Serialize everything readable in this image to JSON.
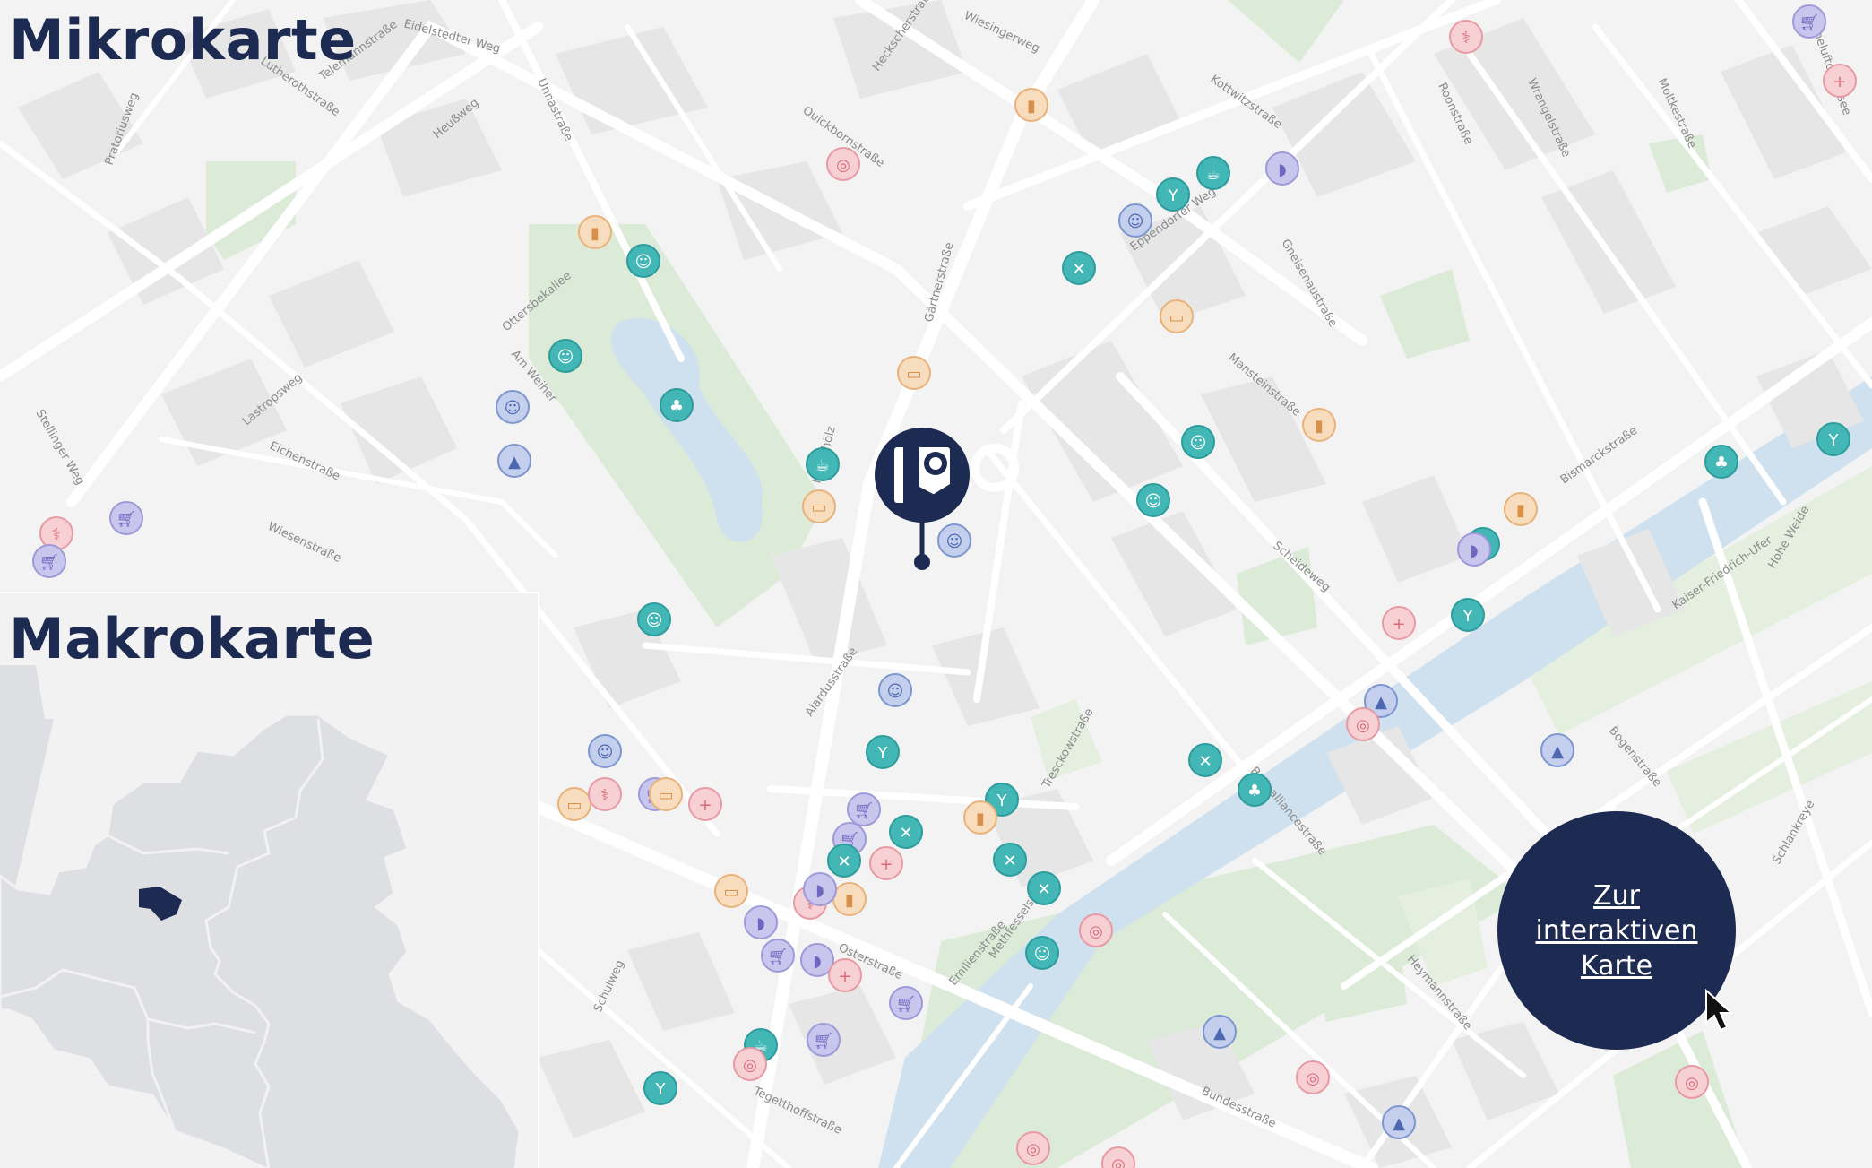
{
  "titles": {
    "micro": "Mikrokarte",
    "macro": "Makrokarte"
  },
  "cta_button": {
    "label": "Zur interaktiven Karte"
  },
  "colors": {
    "navy": "#1d2a52",
    "teal": "#43b6b6",
    "orange": "#f2c89c",
    "purple": "#a9a6da",
    "blue": "#93a7d6",
    "pink": "#f2b2b9",
    "water": "#cfe1ef",
    "park": "#dcebd8"
  },
  "location_marker": {
    "icon": "company-logo-pin-icon"
  },
  "streets": [
    "Eidelstedter Weg",
    "Telemannstraße",
    "Lutherothstraße",
    "Heußweg",
    "Pratoriusweg",
    "Unnastraße",
    "Quickbornstraße",
    "Heckscherstraße",
    "Wiesingerweg",
    "Eppendorfer Weg",
    "Kottwitzstraße",
    "Roonstraße",
    "Wrangelstraße",
    "Moltkestraße",
    "Hoheluftchaussee",
    "Ottersbekallee",
    "Am Weiher",
    "Lastropsweg",
    "Eichenstraße",
    "Wiesenstraße",
    "Stellinger Weg",
    "Im Gehölz",
    "Gärtnerstraße",
    "Alardusstraße",
    "Mansteinstraße",
    "Gneisenaustraße",
    "Bismarckstraße",
    "Scheideweg",
    "Tresckowstraße",
    "Kaiser-Friedrich-Ufer",
    "Hohe Weide",
    "Bogenstraße",
    "Schlankreye",
    "Osterstraße",
    "Schulweg",
    "Tegetthoffstraße",
    "Bundesstraße",
    "Heymannstraße",
    "Bellealliancestraße",
    "Emilienstraße",
    "Methfesselstraße"
  ],
  "poi_categories": [
    "supermarket",
    "restaurant",
    "cafe",
    "bar",
    "pharmacy",
    "kindergarten",
    "school",
    "bus",
    "doctor",
    "sport",
    "park",
    "playground",
    "bakery",
    "fuel"
  ]
}
